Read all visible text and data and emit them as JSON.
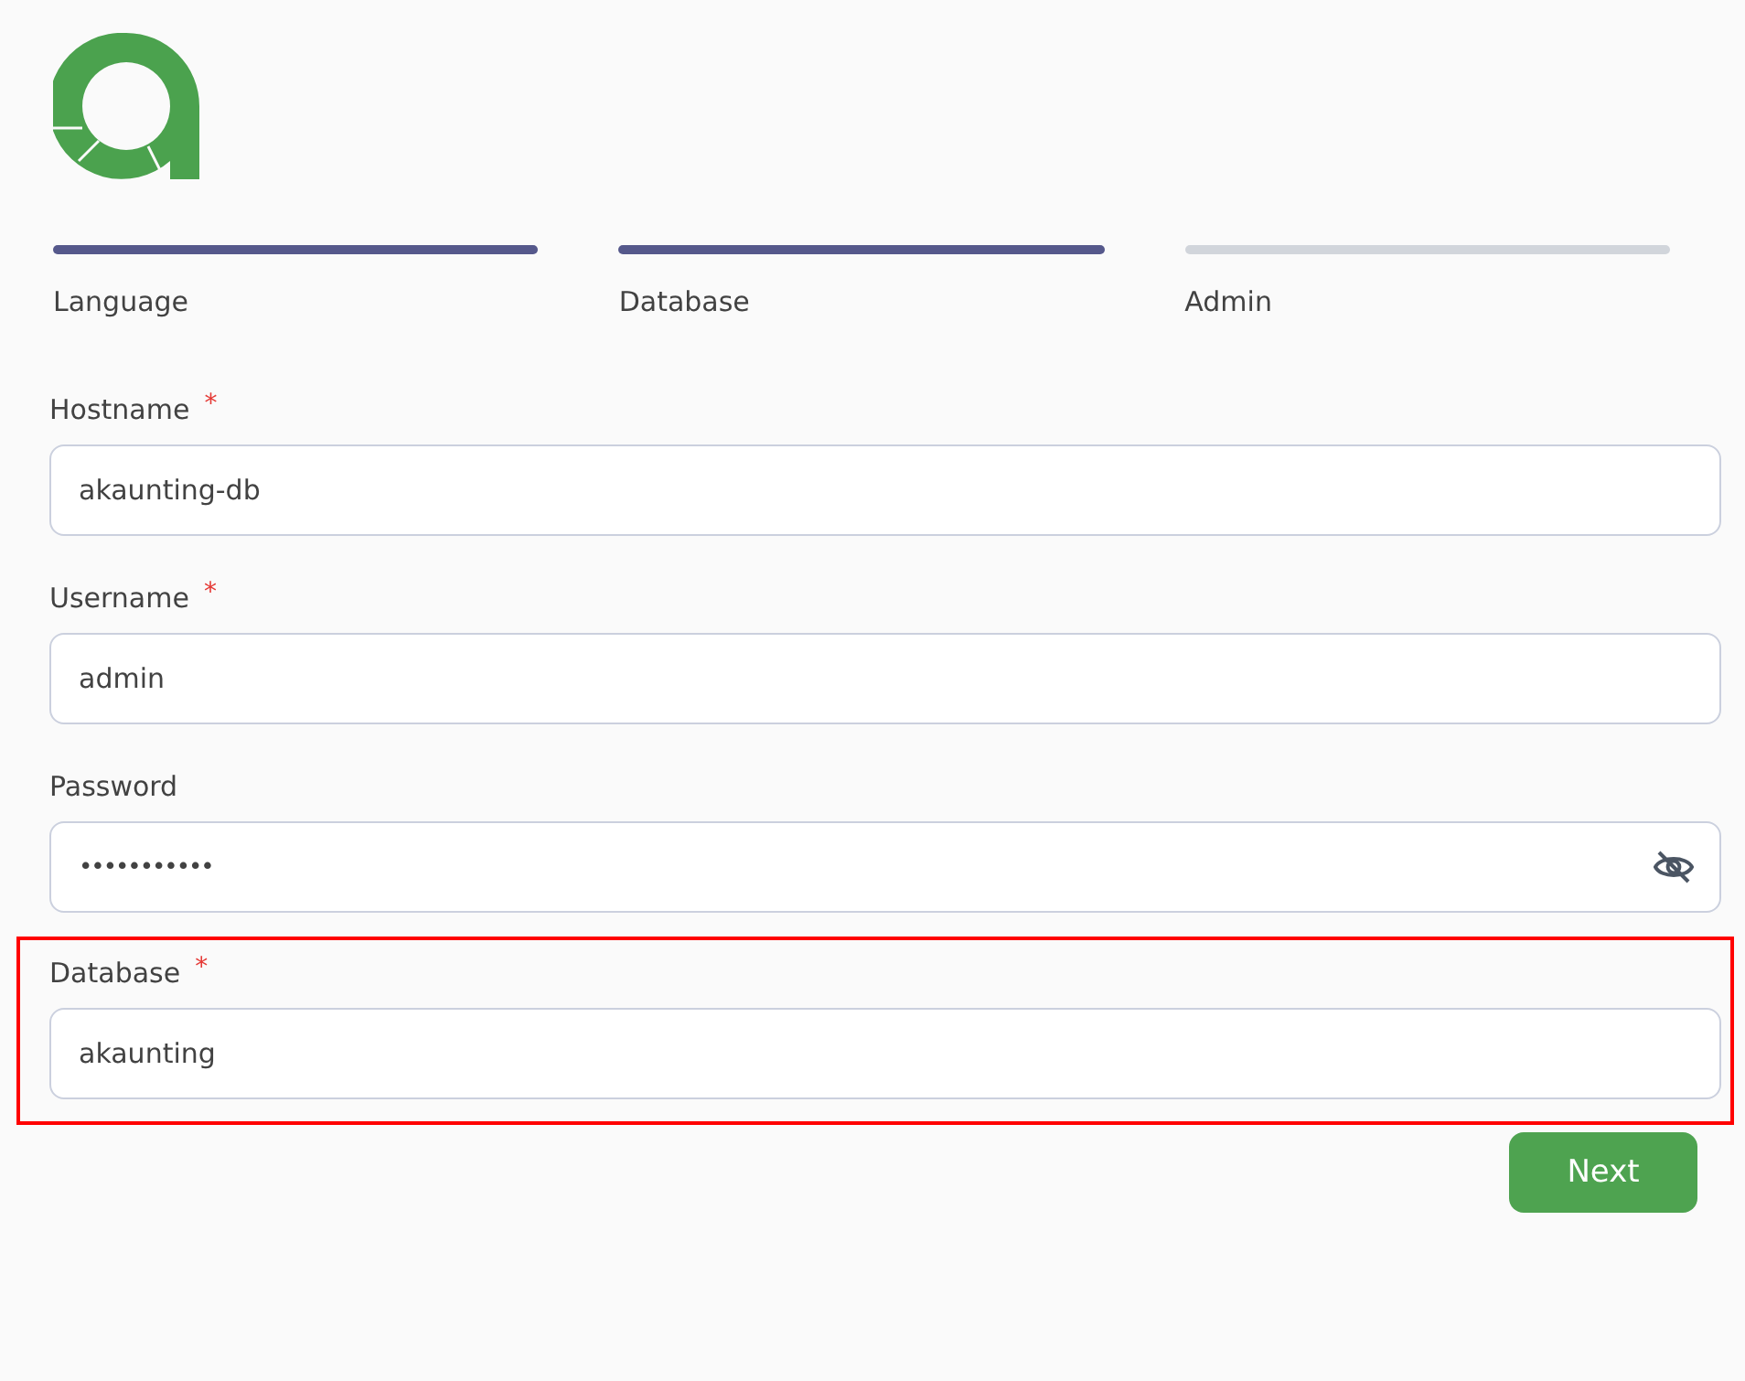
{
  "steps": [
    {
      "label": "Language",
      "done": true
    },
    {
      "label": "Database",
      "done": true
    },
    {
      "label": "Admin",
      "done": false
    }
  ],
  "fields": [
    {
      "label": "Hostname",
      "required_mark": "*",
      "value": "akaunting-db",
      "kind": "text",
      "highlighted": false
    },
    {
      "label": "Username",
      "required_mark": "*",
      "value": "admin",
      "kind": "text",
      "highlighted": false
    },
    {
      "label": "Password",
      "value": "•••••••••••",
      "kind": "password",
      "highlighted": false
    },
    {
      "label": "Database",
      "required_mark": "*",
      "value": "akaunting",
      "kind": "text",
      "highlighted": true
    }
  ],
  "next_button": "Next"
}
